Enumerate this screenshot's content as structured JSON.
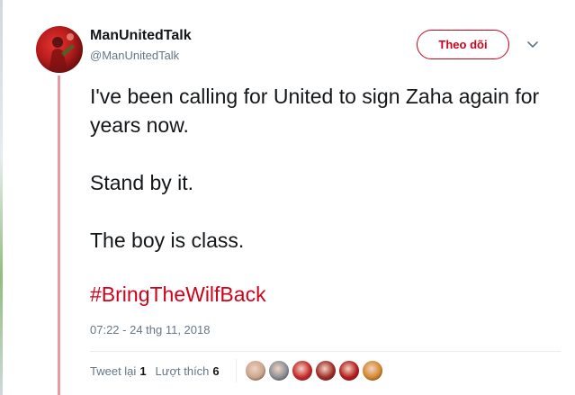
{
  "tweet": {
    "author": {
      "name": "ManUnitedTalk",
      "handle": "@ManUnitedTalk",
      "avatar_icon": "man-utd-player-avatar"
    },
    "follow_label": "Theo dõi",
    "paragraphs": [
      "I've been calling for United to sign Zaha again for years now.",
      "Stand by it.",
      "The boy is class."
    ],
    "hashtag": "#BringTheWilfBack",
    "timestamp": "07:22 - 24 thg 11, 2018",
    "stats": {
      "retweets_label": "Tweet lại",
      "retweets": "1",
      "likes_label": "Lượt thích",
      "likes": "6"
    },
    "likers": [
      {
        "icon": "liker-avatar-1",
        "color": "#c9a58a"
      },
      {
        "icon": "liker-avatar-2",
        "color": "#8a8f96"
      },
      {
        "icon": "liker-avatar-3",
        "color": "#c62828"
      },
      {
        "icon": "liker-avatar-4",
        "color": "#9e2b25"
      },
      {
        "icon": "liker-avatar-5",
        "color": "#b71c1c"
      },
      {
        "icon": "liker-avatar-6",
        "color": "#d4882b"
      }
    ]
  },
  "colors": {
    "accent": "#d0021b",
    "secondary_text": "#657786",
    "thread_line": "#e89aa3"
  }
}
